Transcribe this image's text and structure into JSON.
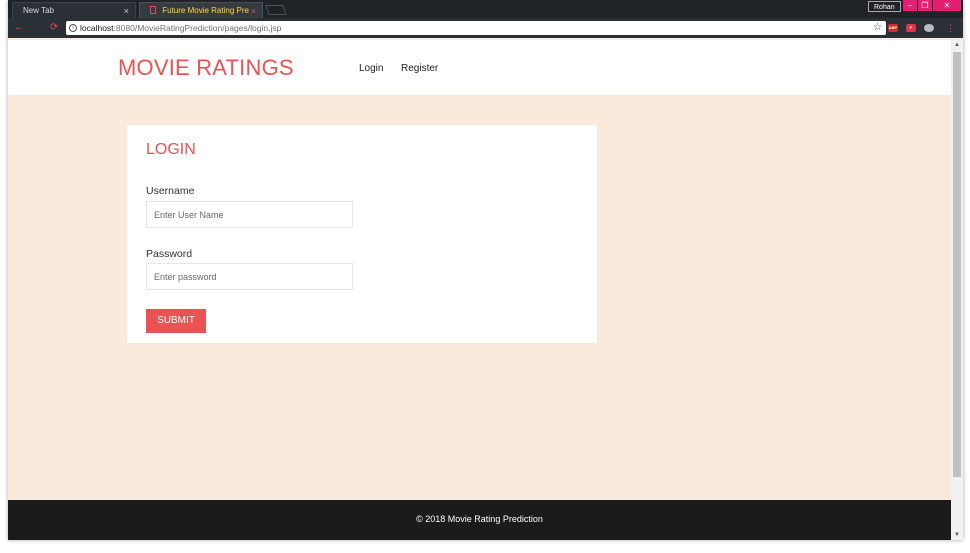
{
  "browser": {
    "tabs": [
      {
        "title": "New Tab"
      },
      {
        "title": "Future Movie Rating Pre"
      }
    ],
    "tab_close_glyph": "×",
    "profile_name": "Rohan",
    "url_host": "localhost",
    "url_rest": ":8080/MovieRatingPrediction/pages/login.jsp",
    "icons": {
      "back": "back-arrow-icon",
      "forward": "forward-arrow-icon",
      "reload": "reload-icon",
      "info": "info-icon",
      "star": "bookmark-star-icon",
      "menu": "kebab-menu-icon"
    },
    "extensions": [
      {
        "label": "ABP"
      },
      {
        "label": "P"
      },
      {
        "label": ""
      }
    ],
    "accent_color": "#e61e73"
  },
  "navbar": {
    "brand": "MOVIE RATINGS",
    "links": [
      {
        "label": "Login"
      },
      {
        "label": "Register"
      }
    ]
  },
  "login_form": {
    "title": "LOGIN",
    "username_label": "Username",
    "username_placeholder": "Enter User Name",
    "username_value": "",
    "password_label": "Password",
    "password_placeholder": "Enter password",
    "password_value": "",
    "submit_label": "SUBMIT"
  },
  "footer": {
    "text": "© 2018 Movie Rating Prediction"
  },
  "colors": {
    "brand_red": "#ea5354",
    "page_background": "#f9eadb",
    "footer_background": "#1b1b1b"
  }
}
